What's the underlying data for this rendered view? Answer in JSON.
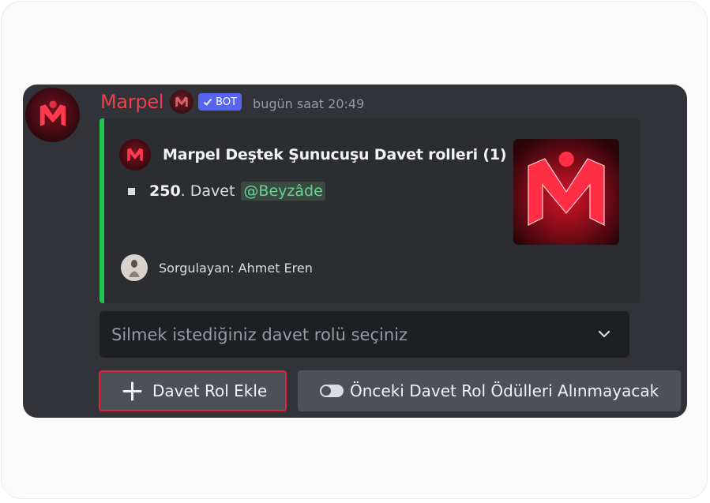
{
  "message": {
    "username": "Marpel",
    "bot_badge": "BOT",
    "timestamp": "bugün saat 20:49"
  },
  "embed": {
    "accent_color": "#23c552",
    "author_name": "Marpel Deştek Şunucuşu Davet rolleri (1)",
    "rank": "250",
    "rank_suffix": ". Davet",
    "mention": "@Beyzâde",
    "footer_text": "Sorgulayan: Ahmet Eren"
  },
  "select_menu": {
    "placeholder": "Silmek istediğiniz davet rolü seçiniz"
  },
  "buttons": {
    "add_label": "Davet Rol Ekle",
    "toggle_label": "Önceki Davet Rol Ödülleri Alınmayacak"
  },
  "colors": {
    "username": "#ef3f4a",
    "bot_badge": "#5865f2",
    "panel_bg": "#313338",
    "embed_bg": "#2b2d31",
    "button_bg": "#4e5058",
    "focus_outline": "#e0203c"
  },
  "icons": {
    "avatar": "marpel-logo-icon",
    "bot_check": "check-icon",
    "select_chevron": "chevron-down-icon",
    "add": "plus-icon",
    "toggle": "toggle-off-icon"
  }
}
